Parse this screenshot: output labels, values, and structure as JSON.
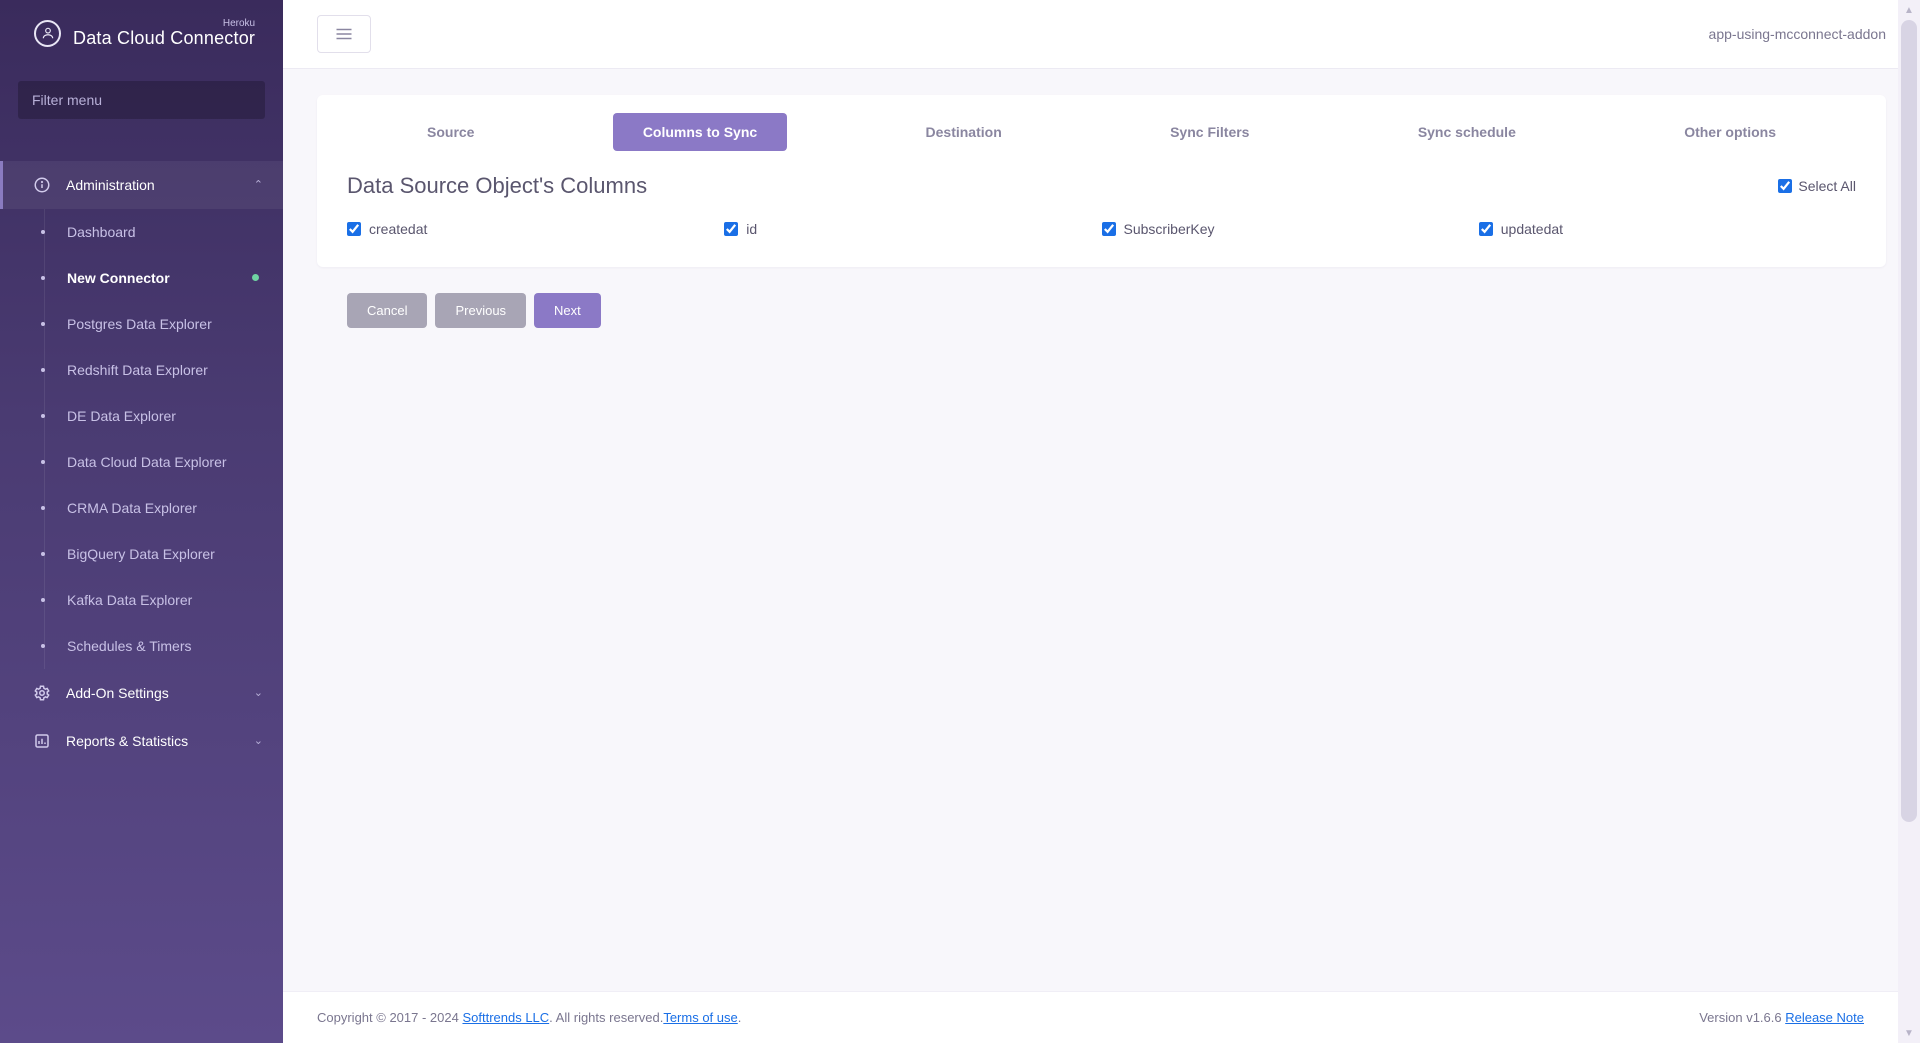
{
  "brand": {
    "sub": "Heroku",
    "main": "Data Cloud Connector"
  },
  "filter": {
    "placeholder": "Filter menu"
  },
  "nav": {
    "sections": [
      {
        "label": "Administration",
        "expanded": true,
        "items": [
          {
            "label": "Dashboard",
            "active": false
          },
          {
            "label": "New Connector",
            "active": true,
            "dot": true
          },
          {
            "label": "Postgres Data Explorer",
            "active": false
          },
          {
            "label": "Redshift Data Explorer",
            "active": false
          },
          {
            "label": "DE Data Explorer",
            "active": false
          },
          {
            "label": "Data Cloud Data Explorer",
            "active": false
          },
          {
            "label": "CRMA Data Explorer",
            "active": false
          },
          {
            "label": "BigQuery Data Explorer",
            "active": false
          },
          {
            "label": "Kafka Data Explorer",
            "active": false
          },
          {
            "label": "Schedules & Timers",
            "active": false
          }
        ]
      },
      {
        "label": "Add-On Settings",
        "expanded": false
      },
      {
        "label": "Reports & Statistics",
        "expanded": false
      }
    ]
  },
  "header": {
    "app_label": "app-using-mcconnect-addon"
  },
  "wizard": {
    "tabs": [
      {
        "label": "Source",
        "active": false
      },
      {
        "label": "Columns to Sync",
        "active": true
      },
      {
        "label": "Destination",
        "active": false
      },
      {
        "label": "Sync Filters",
        "active": false
      },
      {
        "label": "Sync schedule",
        "active": false
      },
      {
        "label": "Other options",
        "active": false
      }
    ],
    "title": "Data Source Object's Columns",
    "select_all_label": "Select All",
    "select_all_checked": true,
    "columns": [
      {
        "label": "createdat",
        "checked": true
      },
      {
        "label": "id",
        "checked": true
      },
      {
        "label": "SubscriberKey",
        "checked": true
      },
      {
        "label": "updatedat",
        "checked": true
      }
    ],
    "buttons": {
      "cancel": "Cancel",
      "previous": "Previous",
      "next": "Next"
    }
  },
  "footer": {
    "copyright_prefix": "Copyright © 2017 - 2024 ",
    "company": "Softtrends LLC",
    "rights": ". All rights reserved.",
    "terms": "Terms of use",
    "period": ".",
    "version_prefix": "Version v1.6.6  ",
    "release": "Release Note"
  }
}
